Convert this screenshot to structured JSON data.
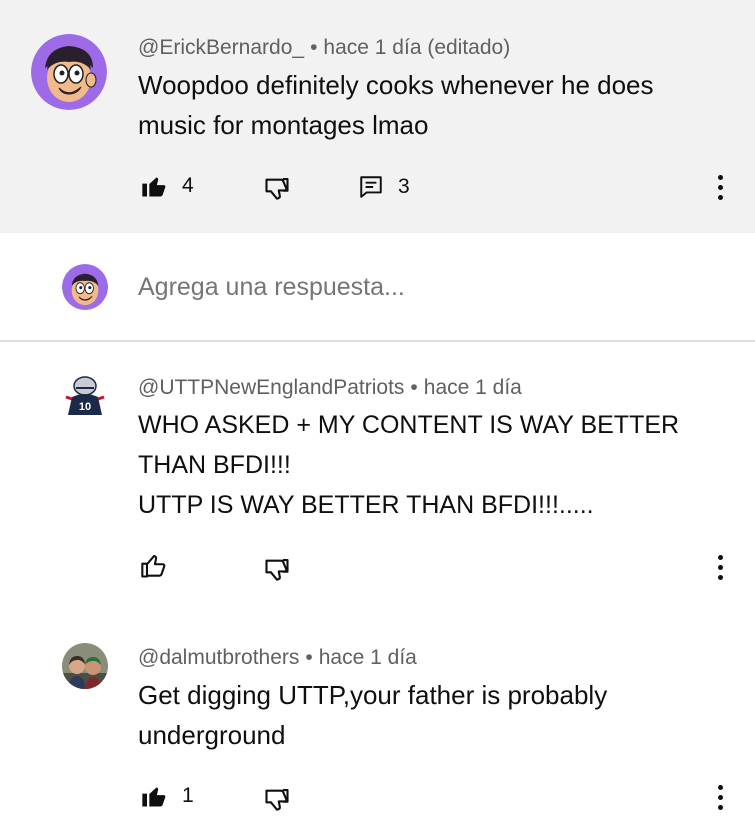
{
  "comments": [
    {
      "handle": "@ErickBernardo_",
      "time": "hace 1 día (editado)",
      "text_lines": [
        "Woopdoo definitely cooks whenever he does",
        "music for montages lmao"
      ],
      "likes": "4",
      "replies": "3",
      "liked": true,
      "avatar_icon": "cartoon-face-avatar"
    },
    {
      "handle": "@UTTPNewEnglandPatriots",
      "time": "hace 1 día",
      "text_lines": [
        "WHO ASKED + MY CONTENT IS WAY BETTER",
        "THAN BFDI!!!",
        "UTTP IS WAY BETTER THAN BFDI!!!....."
      ],
      "likes": "",
      "liked": false,
      "avatar_icon": "football-player-avatar"
    },
    {
      "handle": "@dalmutbrothers",
      "time": "hace 1 día",
      "text_lines": [
        "Get digging UTTP,your father is probably",
        "underground"
      ],
      "likes": "1",
      "liked": true,
      "avatar_icon": "two-people-photo-avatar"
    }
  ],
  "reply_box": {
    "placeholder": "Agrega una respuesta..."
  },
  "separator": "•",
  "colors": {
    "highlight_bg": "#f2f2f2",
    "meta_text": "#606060",
    "primary_text": "#0f0f0f",
    "avatar_purple": "#9d6be8"
  }
}
